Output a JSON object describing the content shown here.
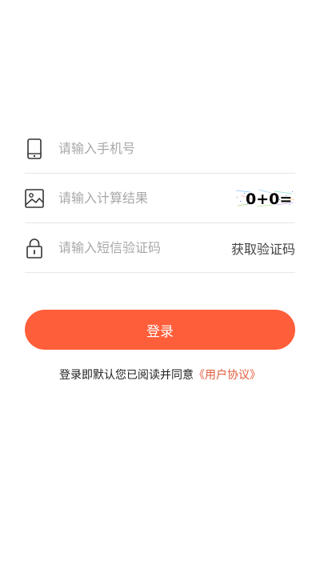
{
  "theme": {
    "accent": "#ff5e3a",
    "link_color": "#e25b3c",
    "placeholder_color": "#a8a8a8",
    "divider_color": "#e6e6e6"
  },
  "form": {
    "phone": {
      "icon": "phone-icon",
      "value": "",
      "placeholder": "请输入手机号"
    },
    "captcha": {
      "icon": "image-icon",
      "value": "",
      "placeholder": "请输入计算结果",
      "image_text": "0+0="
    },
    "sms": {
      "icon": "lock-icon",
      "value": "",
      "placeholder": "请输入短信验证码",
      "button_label": "获取验证码"
    }
  },
  "login_button": {
    "label": "登录"
  },
  "agreement": {
    "text": "登录即默认您已阅读并同意",
    "link_label": "《用户协议》"
  }
}
